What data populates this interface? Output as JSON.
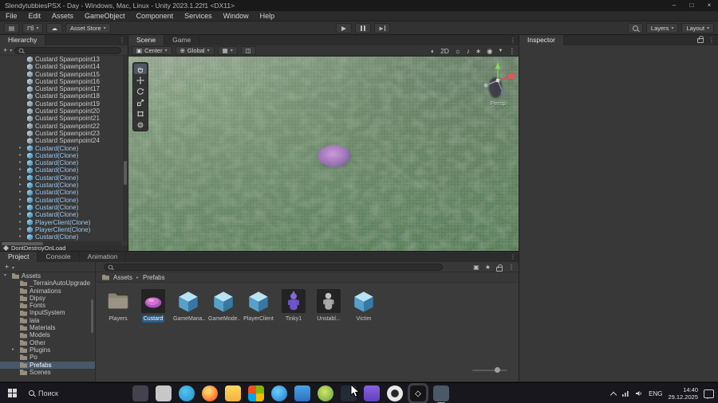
{
  "glyphs": {
    "dropdown": "▾",
    "more": "⋮",
    "expand": "▸",
    "plus": "+",
    "minimize": "–",
    "maximize": "□",
    "close": "×",
    "crumb_sep": "▸"
  },
  "window": {
    "title": "SlendytubbiesPSX - Day - Windows, Mac, Linux - Unity 2023.1.22f1 <DX11>"
  },
  "menu": {
    "items": [
      {
        "label": "File"
      },
      {
        "label": "Edit"
      },
      {
        "label": "Assets"
      },
      {
        "label": "GameObject"
      },
      {
        "label": "Component"
      },
      {
        "label": "Services"
      },
      {
        "label": "Window"
      },
      {
        "label": "Help"
      }
    ]
  },
  "toolbar": {
    "grid_icon": "▤",
    "account_label": "Гб",
    "cloud_icon": "☁",
    "store_label": "Asset Store",
    "layers_label": "Layers",
    "layout_label": "Layout"
  },
  "hierarchy": {
    "tab": "Hierarchy",
    "rows": [
      {
        "label": "Custard Spawnpoint13",
        "arrow": "",
        "cls": ""
      },
      {
        "label": "Custard Spawnpoint14",
        "arrow": "",
        "cls": ""
      },
      {
        "label": "Custard Spawnpoint15",
        "arrow": "",
        "cls": ""
      },
      {
        "label": "Custard Spawnpoint16",
        "arrow": "",
        "cls": ""
      },
      {
        "label": "Custard Spawnpoint17",
        "arrow": "",
        "cls": ""
      },
      {
        "label": "Custard Spawnpoint18",
        "arrow": "",
        "cls": ""
      },
      {
        "label": "Custard Spawnpoint19",
        "arrow": "",
        "cls": ""
      },
      {
        "label": "Custard Spawnpoint20",
        "arrow": "",
        "cls": ""
      },
      {
        "label": "Custard Spawnpoint21",
        "arrow": "",
        "cls": ""
      },
      {
        "label": "Custard Spawnpoint22",
        "arrow": "",
        "cls": ""
      },
      {
        "label": "Custard Spawnpoint23",
        "arrow": "",
        "cls": ""
      },
      {
        "label": "Custard Spawnpoint24",
        "arrow": "",
        "cls": ""
      },
      {
        "label": "Custard(Clone)",
        "arrow": "▸",
        "cls": "pf"
      },
      {
        "label": "Custard(Clone)",
        "arrow": "▸",
        "cls": "pf"
      },
      {
        "label": "Custard(Clone)",
        "arrow": "▸",
        "cls": "pf"
      },
      {
        "label": "Custard(Clone)",
        "arrow": "▸",
        "cls": "pf"
      },
      {
        "label": "Custard(Clone)",
        "arrow": "▸",
        "cls": "pf"
      },
      {
        "label": "Custard(Clone)",
        "arrow": "▸",
        "cls": "pf"
      },
      {
        "label": "Custard(Clone)",
        "arrow": "▸",
        "cls": "pf"
      },
      {
        "label": "Custard(Clone)",
        "arrow": "▸",
        "cls": "pf"
      },
      {
        "label": "Custard(Clone)",
        "arrow": "▸",
        "cls": "pf"
      },
      {
        "label": "Custard(Clone)",
        "arrow": "▸",
        "cls": "pf"
      },
      {
        "label": "PlayerClient(Clone)",
        "arrow": "▸",
        "cls": "pf"
      },
      {
        "label": "PlayerClient(Clone)",
        "arrow": "▸",
        "cls": "pf"
      },
      {
        "label": "Custard(Clone)",
        "arrow": "▸",
        "cls": "pf"
      }
    ],
    "scene_item": "DontDestroyOnLoad"
  },
  "scene": {
    "tabs": [
      {
        "label": "Scene",
        "cls": "active"
      },
      {
        "label": "Game",
        "cls": ""
      }
    ],
    "toolbar": {
      "pivot_icon": "▣",
      "pivot_label": "Center",
      "orientation_icon": "⊕",
      "orientation_label": "Global",
      "grid_icon": "▦",
      "snap_icon": "◫",
      "icons": {
        "render": "◐",
        "mode2d": "2D",
        "lighting": "☼",
        "audio": "♪",
        "effects": "∗",
        "visibility": "◉",
        "camera": "▼",
        "more": "⋮"
      }
    },
    "gizmo_label": "Persp"
  },
  "inspector": {
    "tab": "Inspector"
  },
  "project": {
    "tabs": [
      {
        "label": "Project",
        "cls": "active"
      },
      {
        "label": "Console",
        "cls": ""
      },
      {
        "label": "Animation",
        "cls": ""
      }
    ],
    "toolbar": {
      "star_icon": "★",
      "package_icon": "▣"
    },
    "tree": [
      {
        "label": "Assets",
        "arrow": "▾",
        "cls": ""
      },
      {
        "label": "_TerrainAutoUpgrade",
        "arrow": "",
        "cls": "ind1"
      },
      {
        "label": "Animations",
        "arrow": "",
        "cls": "ind1"
      },
      {
        "label": "Dipsy",
        "arrow": "",
        "cls": "ind1"
      },
      {
        "label": "Fonts",
        "arrow": "",
        "cls": "ind1"
      },
      {
        "label": "InputSystem",
        "arrow": "",
        "cls": "ind1"
      },
      {
        "label": "lala",
        "arrow": "",
        "cls": "ind1"
      },
      {
        "label": "Materials",
        "arrow": "",
        "cls": "ind1"
      },
      {
        "label": "Models",
        "arrow": "",
        "cls": "ind1"
      },
      {
        "label": "Other",
        "arrow": "",
        "cls": "ind1"
      },
      {
        "label": "Plugins",
        "arrow": "▸",
        "cls": "ind1"
      },
      {
        "label": "Po",
        "arrow": "",
        "cls": "ind1"
      },
      {
        "label": "Prefabs",
        "arrow": "",
        "cls": "ind1 sel"
      },
      {
        "label": "Scenes",
        "arrow": "",
        "cls": "ind1"
      }
    ],
    "breadcrumb": {
      "root": "Assets",
      "current": "Prefabs"
    },
    "assets": [
      {
        "label": "Players",
        "cls": "t-folder"
      },
      {
        "label": "Custard",
        "cls": "t-blob sel"
      },
      {
        "label": "GameMana...",
        "cls": "t-cube"
      },
      {
        "label": "GameMode...",
        "cls": "t-cube"
      },
      {
        "label": "PlayerClient",
        "cls": "t-cube"
      },
      {
        "label": "Tinky1",
        "cls": "t-purple"
      },
      {
        "label": "Unstabl...",
        "cls": "t-gray"
      },
      {
        "label": "Victim",
        "cls": "t-cube"
      }
    ]
  },
  "taskbar": {
    "search_label": "Поиск",
    "language": "ENG",
    "time": "14:40",
    "date": "29.12.2025",
    "apps": [
      {
        "cls": "sq",
        "bg": "#45424f",
        "glyph": ""
      },
      {
        "cls": "sq",
        "bg": "#c7c7c7",
        "glyph": ""
      },
      {
        "cls": "ci",
        "bg": "radial-gradient(circle at 40% 35%, #54c2f0, #1e8fd0)",
        "glyph": ""
      },
      {
        "cls": "ci",
        "bg": "radial-gradient(circle at 40% 35%, #ffd166 15%, #ff8a3c 55%, #e23b2e)",
        "glyph": ""
      },
      {
        "cls": "sq",
        "bg": "linear-gradient(180deg,#ffd75e,#f2b33d)",
        "glyph": ""
      },
      {
        "cls": "sq",
        "bg": "conic-gradient(#7fba00 0 25%, #ffb900 0 50%, #00a4ef 0 75%, #f25022 0)",
        "glyph": ""
      },
      {
        "cls": "ci",
        "bg": "radial-gradient(circle at 40% 35%, #6ad0ff, #1d78c9)",
        "glyph": ""
      },
      {
        "cls": "sq",
        "bg": "linear-gradient(180deg,#4aa3e8,#2d6fc0)",
        "glyph": ""
      },
      {
        "cls": "ci",
        "bg": "radial-gradient(circle at 45% 40%, #d9e56a, #58a03c)",
        "glyph": ""
      },
      {
        "cls": "sq",
        "bg": "#222b36",
        "glyph": ""
      },
      {
        "cls": "sq",
        "bg": "linear-gradient(180deg,#8a63e0,#5f3fc0)",
        "glyph": ""
      },
      {
        "cls": "ci",
        "bg": "radial-gradient(circle, #262626 30%, #e9e9e9 38% 70%, #1c1c1c 78%)",
        "glyph": ""
      },
      {
        "cls": "sq active",
        "bg": "#151515",
        "glyph": "◇"
      },
      {
        "cls": "sq open",
        "bg": "#4b5866",
        "glyph": ""
      }
    ]
  }
}
